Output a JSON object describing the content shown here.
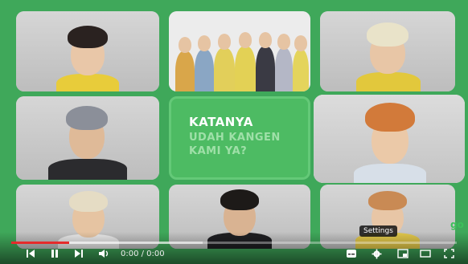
{
  "overlay": {
    "line1": "KATANYA",
    "line2": "UDAH KANGEN",
    "line3": "KAMI YA?"
  },
  "player": {
    "time_display": "0:00 / 0:00",
    "tooltip": "Settings",
    "progress_fraction": 0.13,
    "buffer_fraction": 0.43,
    "channel_logo_text": "go"
  },
  "colors": {
    "background": "#3fa85a",
    "progress_played": "#e52b2b",
    "text_green": "#9fe0a8"
  },
  "icons": [
    "skip-back-icon",
    "pause-icon",
    "skip-next-icon",
    "volume-icon",
    "subtitles-icon",
    "gear-icon",
    "miniplayer-icon",
    "theater-icon",
    "fullscreen-icon"
  ]
}
